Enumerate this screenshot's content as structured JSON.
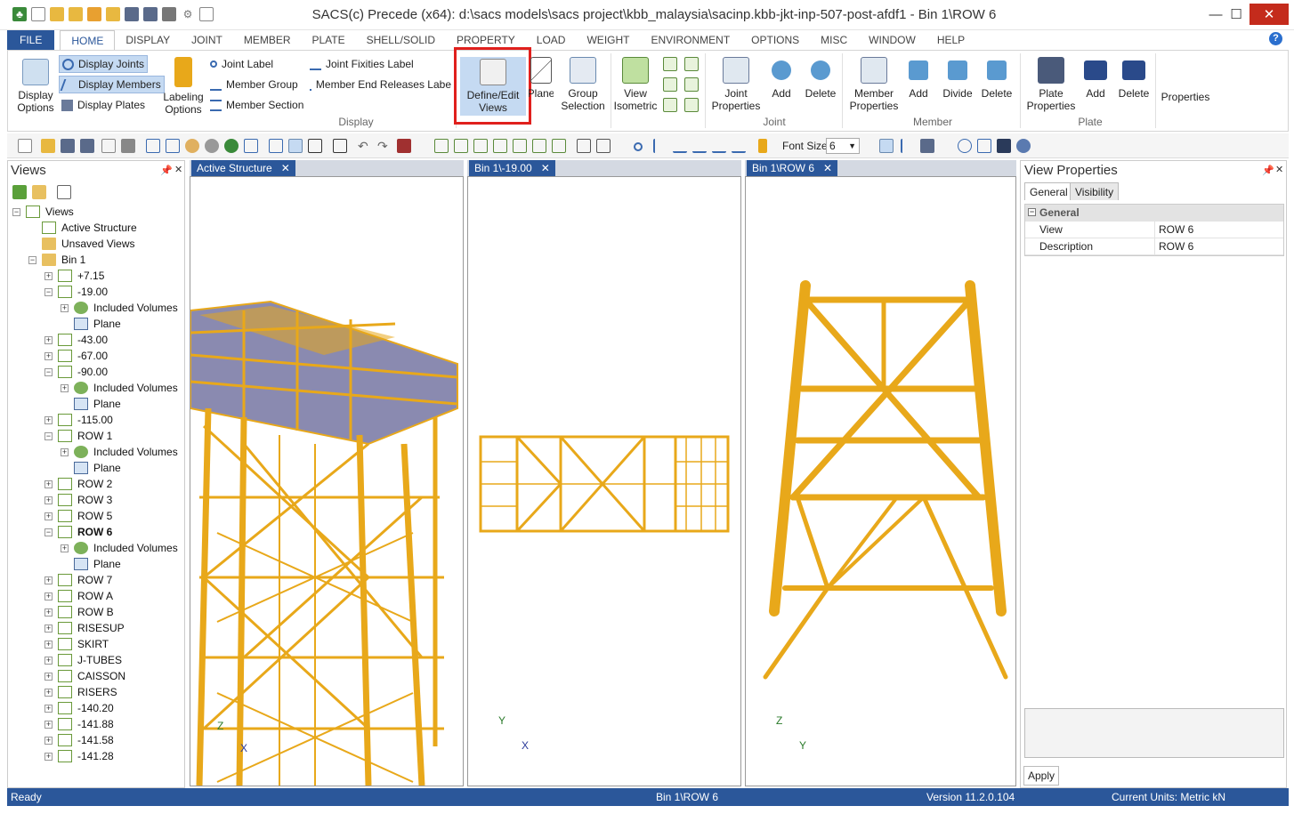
{
  "window": {
    "title": "SACS(c) Precede (x64):  d:\\sacs models\\sacs project\\kbb_malaysia\\sacinp.kbb-jkt-inp-507-post-afdf1 - Bin 1\\ROW 6",
    "minimize": "—",
    "maximize": "☐",
    "close": "✕"
  },
  "ribbon_tabs": [
    "FILE",
    "HOME",
    "DISPLAY",
    "JOINT",
    "MEMBER",
    "PLATE",
    "SHELL/SOLID",
    "PROPERTY",
    "LOAD",
    "WEIGHT",
    "ENVIRONMENT",
    "OPTIONS",
    "MISC",
    "WINDOW",
    "HELP"
  ],
  "ribbon": {
    "display_options": "Display Options",
    "display_joints": "Display Joints",
    "display_members": "Display Members",
    "display_plates": "Display Plates",
    "labeling_options": "Labeling Options",
    "joint_label": "Joint Label",
    "member_group": "Member Group",
    "member_section": "Member Section",
    "joint_fixities_label": "Joint Fixities Label",
    "member_end_releases_label": "Member End Releases Labe",
    "group_display": "Display",
    "define_edit_views": "Define/Edit Views",
    "plane": "Plane",
    "group_selection": "Group Selection",
    "view_isometric": "View Isometric",
    "joint_properties": "Joint Properties",
    "joint_add": "Add",
    "joint_delete": "Delete",
    "group_joint": "Joint",
    "member_properties": "Member Properties",
    "member_add": "Add",
    "member_divide": "Divide",
    "member_delete": "Delete",
    "group_member": "Member",
    "plate_properties": "Plate Properties",
    "plate_add": "Add",
    "plate_delete": "Delete",
    "group_plate": "Plate",
    "properties": "Properties"
  },
  "toolbar": {
    "font_size_label": "Font Size",
    "font_size_value": "6"
  },
  "views_panel": {
    "title": "Views",
    "tree": [
      {
        "label": "Views",
        "level": 0,
        "icon": "views",
        "exp": "−"
      },
      {
        "label": "Active Structure",
        "level": 1,
        "icon": "view",
        "exp": ""
      },
      {
        "label": "Unsaved Views",
        "level": 1,
        "icon": "folder",
        "exp": ""
      },
      {
        "label": "Bin 1",
        "level": 1,
        "icon": "folder",
        "exp": "−"
      },
      {
        "label": "+7.15",
        "level": 2,
        "icon": "view",
        "exp": "+"
      },
      {
        "label": "-19.00",
        "level": 2,
        "icon": "view",
        "exp": "−"
      },
      {
        "label": "Included Volumes",
        "level": 3,
        "icon": "vol",
        "exp": "+"
      },
      {
        "label": "Plane",
        "level": 3,
        "icon": "plane",
        "exp": ""
      },
      {
        "label": "-43.00",
        "level": 2,
        "icon": "view",
        "exp": "+"
      },
      {
        "label": "-67.00",
        "level": 2,
        "icon": "view",
        "exp": "+"
      },
      {
        "label": "-90.00",
        "level": 2,
        "icon": "view",
        "exp": "−"
      },
      {
        "label": "Included Volumes",
        "level": 3,
        "icon": "vol",
        "exp": "+"
      },
      {
        "label": "Plane",
        "level": 3,
        "icon": "plane",
        "exp": ""
      },
      {
        "label": "-115.00",
        "level": 2,
        "icon": "view",
        "exp": "+"
      },
      {
        "label": "ROW 1",
        "level": 2,
        "icon": "view",
        "exp": "−"
      },
      {
        "label": "Included Volumes",
        "level": 3,
        "icon": "vol",
        "exp": "+"
      },
      {
        "label": "Plane",
        "level": 3,
        "icon": "plane",
        "exp": ""
      },
      {
        "label": "ROW 2",
        "level": 2,
        "icon": "view",
        "exp": "+"
      },
      {
        "label": "ROW 3",
        "level": 2,
        "icon": "view",
        "exp": "+"
      },
      {
        "label": "ROW 5",
        "level": 2,
        "icon": "view",
        "exp": "+"
      },
      {
        "label": "ROW 6",
        "level": 2,
        "icon": "view",
        "exp": "−",
        "bold": true
      },
      {
        "label": "Included Volumes",
        "level": 3,
        "icon": "vol",
        "exp": "+"
      },
      {
        "label": "Plane",
        "level": 3,
        "icon": "plane",
        "exp": ""
      },
      {
        "label": "ROW 7",
        "level": 2,
        "icon": "view",
        "exp": "+"
      },
      {
        "label": "ROW A",
        "level": 2,
        "icon": "view",
        "exp": "+"
      },
      {
        "label": "ROW B",
        "level": 2,
        "icon": "view",
        "exp": "+"
      },
      {
        "label": "RISESUP",
        "level": 2,
        "icon": "view",
        "exp": "+"
      },
      {
        "label": "SKIRT",
        "level": 2,
        "icon": "view",
        "exp": "+"
      },
      {
        "label": "J-TUBES",
        "level": 2,
        "icon": "view",
        "exp": "+"
      },
      {
        "label": "CAISSON",
        "level": 2,
        "icon": "view",
        "exp": "+"
      },
      {
        "label": "RISERS",
        "level": 2,
        "icon": "view",
        "exp": "+"
      },
      {
        "label": "-140.20",
        "level": 2,
        "icon": "view",
        "exp": "+"
      },
      {
        "label": "-141.88",
        "level": 2,
        "icon": "view",
        "exp": "+"
      },
      {
        "label": "-141.58",
        "level": 2,
        "icon": "view",
        "exp": "+"
      },
      {
        "label": "-141.28",
        "level": 2,
        "icon": "view",
        "exp": "+"
      }
    ]
  },
  "doc_tabs": {
    "tab1": "Active Structure",
    "tab2": "Bin 1\\-19.00",
    "tab3": "Bin 1\\ROW 6",
    "close": "✕"
  },
  "axes": {
    "vp1": [
      "Z",
      "X"
    ],
    "vp2": [
      "Y",
      "X"
    ],
    "vp3": [
      "Z",
      "Y"
    ]
  },
  "properties_panel": {
    "title": "View Properties",
    "tab_general": "General",
    "tab_visibility": "Visibility",
    "category": "General",
    "rows": [
      {
        "key": "View",
        "value": "ROW 6"
      },
      {
        "key": "Description",
        "value": "ROW 6"
      }
    ],
    "apply": "Apply"
  },
  "status": {
    "left": "Ready",
    "center": "Bin 1\\ROW 6",
    "version": "Version 11.2.0.104",
    "units": "Current Units: Metric kN"
  },
  "colors": {
    "structure": "#e8a81a",
    "structure_dark": "#b07a0a",
    "accent": "#2b579a",
    "highlight": "#e0201d"
  }
}
